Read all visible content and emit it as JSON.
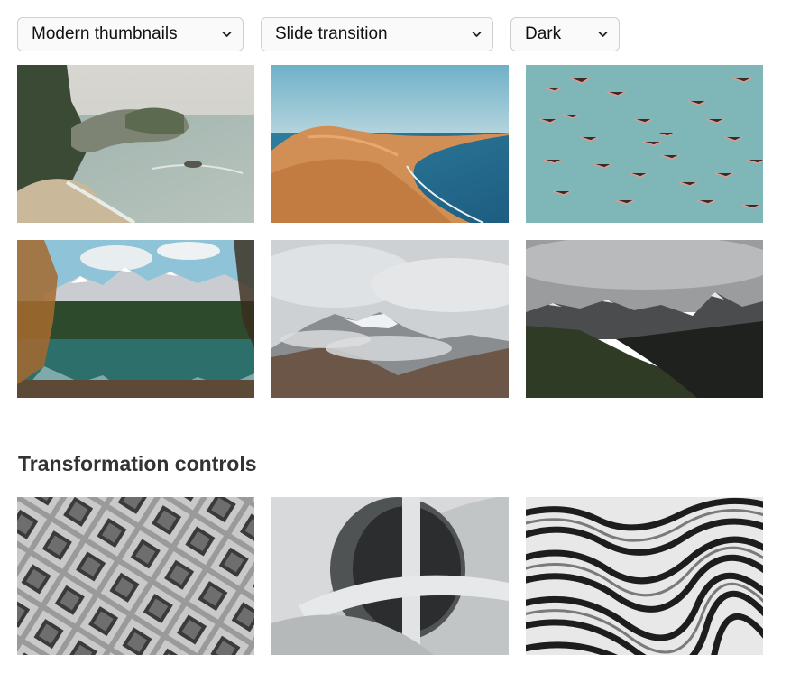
{
  "controls": {
    "thumbnail_style": {
      "value": "Modern thumbnails"
    },
    "transition": {
      "value": "Slide transition"
    },
    "theme": {
      "value": "Dark"
    }
  },
  "sections": {
    "transformation": {
      "title": "Transformation controls"
    }
  }
}
